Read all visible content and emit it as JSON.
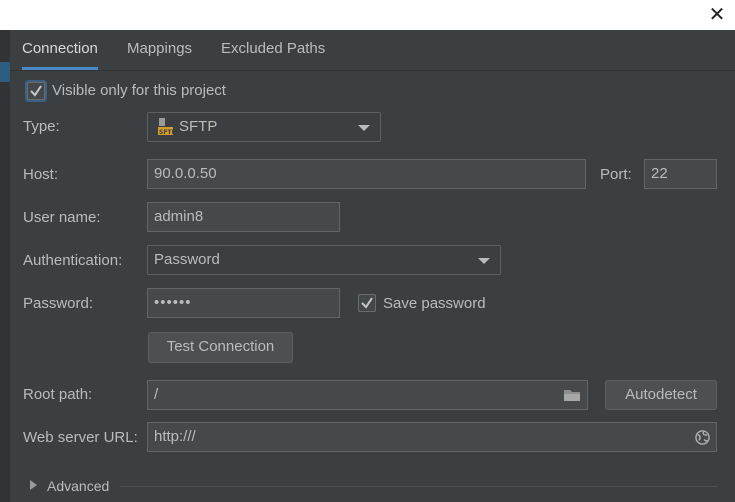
{
  "tabs": [
    {
      "label": "Connection",
      "active": true
    },
    {
      "label": "Mappings",
      "active": false
    },
    {
      "label": "Excluded Paths",
      "active": false
    }
  ],
  "visible_only": {
    "label": "Visible only for this project",
    "checked": true
  },
  "type": {
    "label": "Type:",
    "value": "SFTP",
    "icon": "sftp-icon"
  },
  "host": {
    "label": "Host:",
    "value": "90.0.0.50"
  },
  "port": {
    "label": "Port:",
    "value": "22"
  },
  "username": {
    "label": "User name:",
    "value": "admin8"
  },
  "authentication": {
    "label": "Authentication:",
    "value": "Password"
  },
  "password": {
    "label": "Password:",
    "value": "••••••"
  },
  "save_password": {
    "label": "Save password",
    "checked": true
  },
  "test_connection": {
    "label": "Test Connection"
  },
  "root_path": {
    "label": "Root path:",
    "value": "/",
    "icon": "folder-icon"
  },
  "autodetect": {
    "label": "Autodetect"
  },
  "web_server_url": {
    "label": "Web server URL:",
    "value": "http:///",
    "icon": "globe-icon"
  },
  "advanced": {
    "label": "Advanced"
  },
  "colors": {
    "accent": "#4a88c7",
    "background": "#3c3f41",
    "field": "#45494a"
  }
}
